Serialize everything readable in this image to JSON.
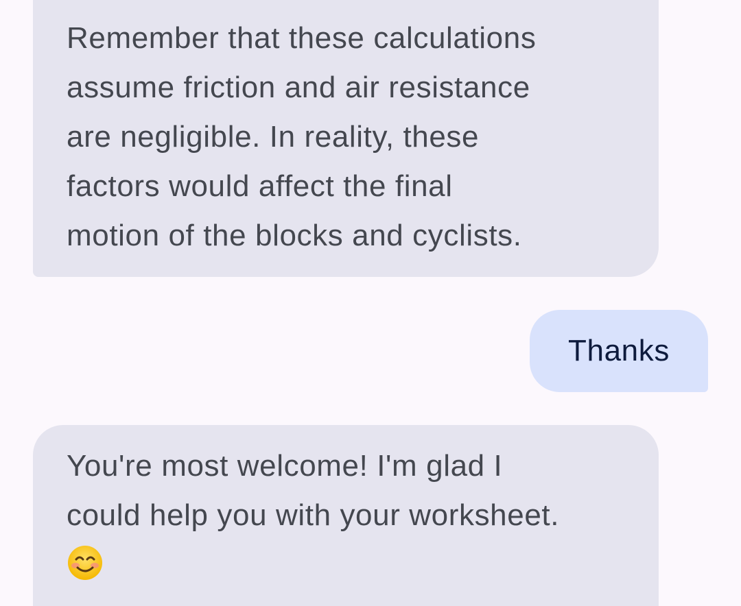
{
  "messages": [
    {
      "role": "assistant",
      "text": "Remember that these calculations\nassume friction and air resistance\nare negligible. In reality, these\nfactors would affect the final\nmotion of the blocks and cyclists."
    },
    {
      "role": "user",
      "text": "Thanks"
    },
    {
      "role": "assistant",
      "text": "You're most welcome! I'm glad I\ncould help you with your worksheet.",
      "emoji": "smiling-face-icon"
    }
  ],
  "colors": {
    "background": "#fcf8fd",
    "assistant_bubble": "#e5e4ef",
    "assistant_text": "#44474f",
    "user_bubble": "#d9e2fc",
    "user_text": "#0e1b3d"
  }
}
